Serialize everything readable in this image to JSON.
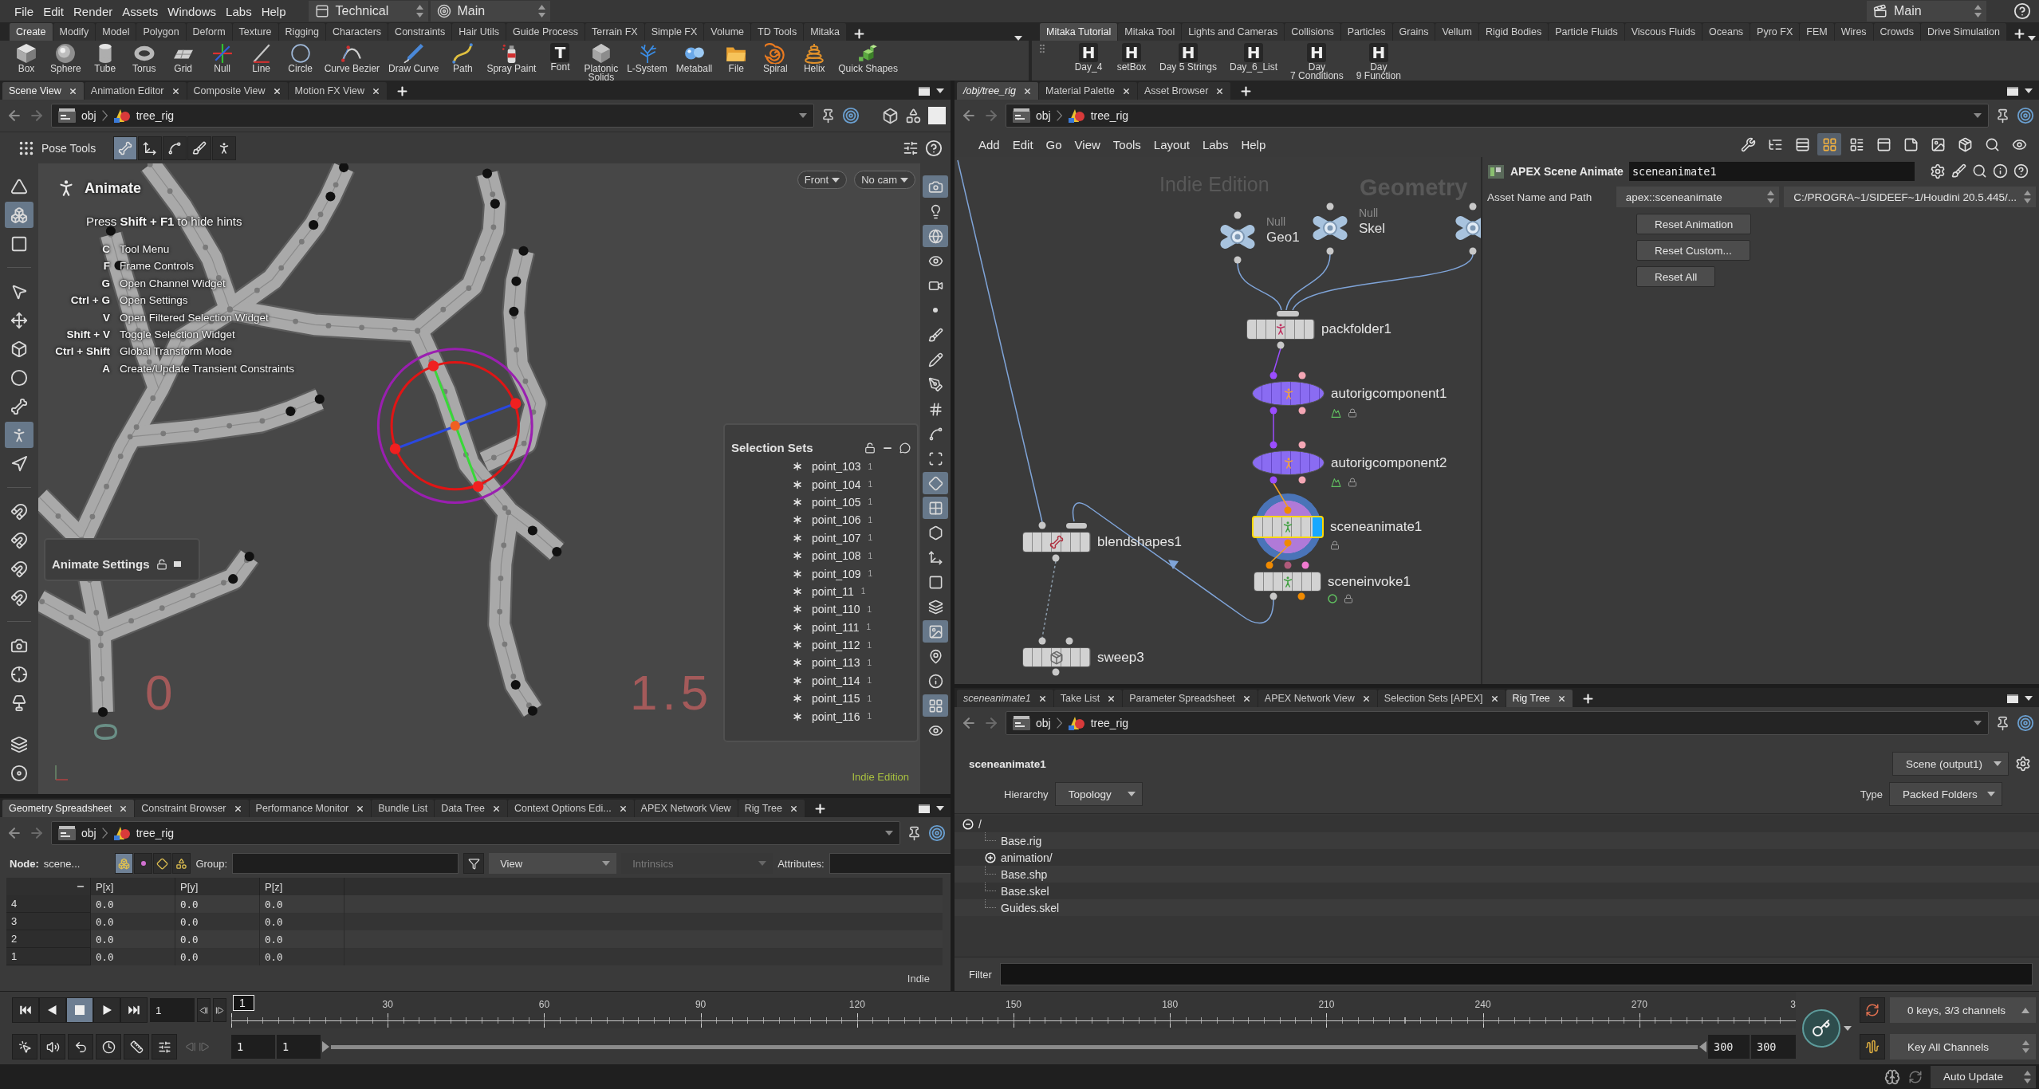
{
  "menu_bar": {
    "menus": [
      "File",
      "Edit",
      "Render",
      "Assets",
      "Windows",
      "Labs",
      "Help"
    ],
    "desktop": "Technical",
    "context": "Main",
    "right_context": "Main"
  },
  "shelf_left": {
    "tabs": [
      {
        "label": "Create",
        "selected": true
      },
      {
        "label": "Modify",
        "selected": false
      },
      {
        "label": "Model",
        "selected": false
      },
      {
        "label": "Polygon",
        "selected": false
      },
      {
        "label": "Deform",
        "selected": false
      },
      {
        "label": "Texture",
        "selected": false
      },
      {
        "label": "Rigging",
        "selected": false
      },
      {
        "label": "Characters",
        "selected": false
      },
      {
        "label": "Constraints",
        "selected": false
      },
      {
        "label": "Hair Utils",
        "selected": false
      },
      {
        "label": "Guide Process",
        "selected": false
      },
      {
        "label": "Terrain FX",
        "selected": false
      },
      {
        "label": "Simple FX",
        "selected": false
      },
      {
        "label": "Volume",
        "selected": false
      },
      {
        "label": "TD Tools",
        "selected": false
      },
      {
        "label": "Mitaka",
        "selected": false
      }
    ],
    "tools": [
      {
        "label": "Box"
      },
      {
        "label": "Sphere"
      },
      {
        "label": "Tube"
      },
      {
        "label": "Torus"
      },
      {
        "label": "Grid"
      },
      {
        "label": "Null"
      },
      {
        "label": "Line"
      },
      {
        "label": "Circle"
      },
      {
        "label": "Curve Bezier"
      },
      {
        "label": "Draw Curve"
      },
      {
        "label": "Path"
      },
      {
        "label": "Spray Paint"
      },
      {
        "label": "Font",
        "glyph": "T"
      },
      {
        "label": "Platonic\nSolids"
      },
      {
        "label": "L-System"
      },
      {
        "label": "Metaball"
      },
      {
        "label": "File"
      },
      {
        "label": "Spiral"
      },
      {
        "label": "Helix"
      },
      {
        "label": "Quick Shapes"
      }
    ]
  },
  "shelf_right": {
    "tabs": [
      {
        "label": "Mitaka Tutorial",
        "selected": true
      },
      {
        "label": "Mitaka Tool",
        "selected": false
      },
      {
        "label": "Lights and Cameras",
        "selected": false
      },
      {
        "label": "Collisions",
        "selected": false
      },
      {
        "label": "Particles",
        "selected": false
      },
      {
        "label": "Grains",
        "selected": false
      },
      {
        "label": "Vellum",
        "selected": false
      },
      {
        "label": "Rigid Bodies",
        "selected": false
      },
      {
        "label": "Particle Fluids",
        "selected": false
      },
      {
        "label": "Viscous Fluids",
        "selected": false
      },
      {
        "label": "Oceans",
        "selected": false
      },
      {
        "label": "Pyro FX",
        "selected": false
      },
      {
        "label": "FEM",
        "selected": false
      },
      {
        "label": "Wires",
        "selected": false
      },
      {
        "label": "Crowds",
        "selected": false
      },
      {
        "label": "Drive Simulation",
        "selected": false
      }
    ],
    "tools": [
      {
        "label": "Day_4",
        "glyph": "H"
      },
      {
        "label": "setBox",
        "glyph": "H"
      },
      {
        "label": "Day 5 Strings",
        "glyph": "H"
      },
      {
        "label": "Day_6_List",
        "glyph": "H"
      },
      {
        "label": "Day\n7 Conditions",
        "glyph": "H"
      },
      {
        "label": "Day\n9 Function",
        "glyph": "H"
      }
    ]
  },
  "scene_view": {
    "tabs": [
      {
        "label": "Scene View",
        "selected": true,
        "closable": true
      },
      {
        "label": "Animation Editor",
        "selected": false,
        "closable": true
      },
      {
        "label": "Composite View",
        "selected": false,
        "closable": true
      },
      {
        "label": "Motion FX View",
        "selected": false,
        "closable": true
      }
    ],
    "path": [
      "obj",
      "tree_rig"
    ],
    "toolbar_label": "Pose Tools",
    "pose_tools": [
      {
        "selected": true
      },
      {
        "selected": false
      },
      {
        "selected": false
      },
      {
        "selected": false
      },
      {
        "selected": false
      }
    ],
    "left_tools": [
      {
        "selected": false
      },
      {
        "selected": true
      },
      {
        "selected": false
      },
      {
        "selected": false
      },
      {
        "selected": false
      },
      {
        "selected": false
      },
      {
        "selected": false
      },
      {
        "selected": false
      },
      {
        "selected": true
      },
      {
        "selected": false
      },
      {
        "selected": false
      },
      {
        "selected": false
      },
      {
        "selected": false
      },
      {
        "selected": false
      },
      {
        "selected": false
      },
      {
        "selected": false
      },
      {
        "selected": false
      },
      {
        "selected": false
      },
      {
        "selected": false
      }
    ],
    "right_tools": [
      {
        "selected": true
      },
      {
        "selected": false
      },
      {
        "selected": true
      },
      {
        "selected": false
      },
      {
        "selected": false
      },
      {
        "selected": false
      },
      {
        "selected": false
      },
      {
        "selected": false
      },
      {
        "selected": false
      },
      {
        "selected": false
      },
      {
        "selected": false
      },
      {
        "selected": false
      },
      {
        "selected": true
      },
      {
        "selected": true
      },
      {
        "selected": false
      },
      {
        "selected": false
      },
      {
        "selected": false
      },
      {
        "selected": false
      },
      {
        "selected": true
      },
      {
        "selected": false
      },
      {
        "selected": false
      },
      {
        "selected": true
      },
      {
        "selected": false
      }
    ],
    "hints": {
      "title": "Animate",
      "note": "Press **Shift + F1** to hide hints",
      "items": [
        {
          "key": "C",
          "label": "Tool Menu"
        },
        {
          "key": "F",
          "label": "Frame Controls"
        },
        {
          "key": "G",
          "label": "Open Channel Widget"
        },
        {
          "key": "Ctrl + G",
          "label": "Open Settings"
        },
        {
          "key": "V",
          "label": "Open Filtered Selection Widget"
        },
        {
          "key": "Shift + V",
          "label": "Toggle Selection Widget"
        },
        {
          "key": "Ctrl + Shift",
          "label": "Global Transform Mode"
        },
        {
          "key": "A",
          "label": "Create/Update Transient Constraints"
        }
      ]
    },
    "view_menus": [
      "Front",
      "No cam"
    ],
    "grid_labels": [
      {
        "text": "0",
        "kind": "x"
      },
      {
        "text": "1.5",
        "kind": "x"
      },
      {
        "text": "0",
        "kind": "z"
      }
    ],
    "animate_settings": "Animate Settings",
    "selection_sets": {
      "title": "Selection Sets",
      "items": [
        {
          "name": "point_103",
          "count": "1"
        },
        {
          "name": "point_104",
          "count": "1"
        },
        {
          "name": "point_105",
          "count": "1"
        },
        {
          "name": "point_106",
          "count": "1"
        },
        {
          "name": "point_107",
          "count": "1"
        },
        {
          "name": "point_108",
          "count": "1"
        },
        {
          "name": "point_109",
          "count": "1"
        },
        {
          "name": "point_11",
          "count": "1"
        },
        {
          "name": "point_110",
          "count": "1"
        },
        {
          "name": "point_111",
          "count": "1"
        },
        {
          "name": "point_112",
          "count": "1"
        },
        {
          "name": "point_113",
          "count": "1"
        },
        {
          "name": "point_114",
          "count": "1"
        },
        {
          "name": "point_115",
          "count": "1"
        },
        {
          "name": "point_116",
          "count": "1"
        }
      ]
    },
    "edition": "Indie Edition"
  },
  "spreadsheet": {
    "tabs": [
      {
        "label": "Geometry Spreadsheet",
        "selected": true,
        "closable": true
      },
      {
        "label": "Constraint Browser",
        "selected": false,
        "closable": true
      },
      {
        "label": "Performance Monitor",
        "selected": false,
        "closable": true
      },
      {
        "label": "Bundle List",
        "selected": false,
        "closable": false
      },
      {
        "label": "Data Tree",
        "selected": false,
        "closable": true
      },
      {
        "label": "Context Options Edi...",
        "selected": false,
        "closable": true
      },
      {
        "label": "APEX Network View",
        "selected": false,
        "closable": false
      },
      {
        "label": "Rig Tree",
        "selected": false,
        "closable": true
      }
    ],
    "path": [
      "obj",
      "tree_rig"
    ],
    "node_label": "Node:",
    "node": "scene...",
    "modes": [
      {
        "selected": true
      },
      {
        "selected": false
      },
      {
        "selected": false
      },
      {
        "selected": false
      }
    ],
    "group_label": "Group:",
    "view": "View",
    "intrinsics": {
      "label": "Intrinsics",
      "disabled": true
    },
    "attributes_label": "Attributes:",
    "columns": [
      "P[x]",
      "P[y]",
      "P[z]"
    ],
    "rows": [
      {
        "index": "4",
        "values": [
          "0.0",
          "0.0",
          "0.0"
        ]
      },
      {
        "index": "3",
        "values": [
          "0.0",
          "0.0",
          "0.0"
        ]
      },
      {
        "index": "2",
        "values": [
          "0.0",
          "0.0",
          "0.0"
        ]
      },
      {
        "index": "1",
        "values": [
          "0.0",
          "0.0",
          "0.0"
        ]
      }
    ],
    "edition": "Indie"
  },
  "network": {
    "tabs": [
      {
        "label": "/obj/tree_rig",
        "kind": "node",
        "selected": true,
        "closable": true
      },
      {
        "label": "Material Palette",
        "kind": "panel",
        "selected": false,
        "closable": true
      },
      {
        "label": "Asset Browser",
        "kind": "panel",
        "selected": false,
        "closable": true
      }
    ],
    "path": [
      "obj",
      "tree_rig"
    ],
    "menus": [
      "Add",
      "Edit",
      "Go",
      "View",
      "Tools",
      "Layout",
      "Labs",
      "Help"
    ],
    "toolbar": [
      {
        "selected": false
      },
      {
        "selected": false
      },
      {
        "selected": false
      },
      {
        "selected": true
      },
      {
        "selected": false
      },
      {
        "selected": false
      },
      {
        "selected": false
      },
      {
        "selected": false
      },
      {
        "selected": false
      },
      {
        "selected": false
      },
      {
        "selected": false
      }
    ],
    "edition_label": "Indie Edition",
    "context_label": "Geometry",
    "nodes": [
      {
        "kind": "null",
        "type": "Null",
        "name": "Geo1",
        "selected": false
      },
      {
        "kind": "null",
        "type": "Null",
        "name": "Skel",
        "selected": false
      },
      {
        "kind": "null",
        "selected": false
      },
      {
        "kind": "box",
        "name": "packfolder1",
        "selected": false,
        "display": false
      },
      {
        "kind": "oval",
        "name": "autorigcomponent1",
        "selected": false,
        "display": false
      },
      {
        "kind": "oval",
        "name": "autorigcomponent2",
        "selected": false,
        "display": false
      },
      {
        "kind": "box",
        "name": "sceneanimate1",
        "selected": true,
        "display": true
      },
      {
        "kind": "box",
        "name": "sceneinvoke1",
        "selected": false,
        "display": false
      },
      {
        "kind": "box",
        "name": "blendshapes1",
        "selected": false,
        "display": false
      },
      {
        "kind": "box",
        "name": "sweep3",
        "selected": false,
        "display": false
      }
    ],
    "parameters": {
      "title": "APEX Scene Animate",
      "node_name": "sceneanimate1",
      "asset_label": "Asset Name and Path",
      "asset": "apex::sceneanimate",
      "asset_path": "C:/PROGRA~1/SIDEEF~1/Houdini 20.5.445/...",
      "buttons": [
        "Reset Animation",
        "Reset Custom...",
        "Reset All"
      ]
    }
  },
  "rig_tree": {
    "tabs": [
      {
        "label": "sceneanimate1",
        "kind": "node",
        "selected": false,
        "closable": true
      },
      {
        "label": "Take List",
        "kind": "panel",
        "selected": false,
        "closable": true
      },
      {
        "label": "Parameter Spreadsheet",
        "kind": "panel",
        "selected": false,
        "closable": true
      },
      {
        "label": "APEX Network View",
        "kind": "panel",
        "selected": false,
        "closable": true
      },
      {
        "label": "Selection Sets [APEX]",
        "kind": "panel",
        "selected": false,
        "closable": true
      },
      {
        "label": "Rig Tree",
        "kind": "panel",
        "selected": true,
        "closable": true
      }
    ],
    "path": [
      "obj",
      "tree_rig"
    ],
    "title": "sceneanimate1",
    "output": "Scene (output1)",
    "hierarchy_label": "Hierarchy",
    "hierarchy": "Topology",
    "type_label": "Type",
    "type": "Packed Folders",
    "tree": [
      {
        "label": "/",
        "kind": "folder",
        "expanded": true,
        "children": [
          {
            "label": "Base.rig",
            "kind": "leaf"
          },
          {
            "label": "animation/",
            "kind": "folder",
            "expanded": false
          },
          {
            "label": "Base.shp",
            "kind": "leaf"
          },
          {
            "label": "Base.skel",
            "kind": "leaf"
          },
          {
            "label": "Guides.skel",
            "kind": "leaf"
          }
        ]
      }
    ],
    "filter_label": "Filter"
  },
  "timeline": {
    "transport": [
      {
        "selected": false
      },
      {
        "selected": false
      },
      {
        "selected": true
      },
      {
        "selected": false
      },
      {
        "selected": false
      }
    ],
    "frame": "1",
    "current_frame": "1",
    "ticks": [
      "30",
      "60",
      "90",
      "120",
      "150",
      "180",
      "210",
      "240",
      "270",
      "3"
    ],
    "start": "1",
    "start_alt": "1",
    "end": "300",
    "end_alt": "300",
    "keys": "0 keys, 3/3 channels",
    "key_mode": "Key All Channels"
  },
  "status_bar": {
    "update_mode": "Auto Update"
  }
}
